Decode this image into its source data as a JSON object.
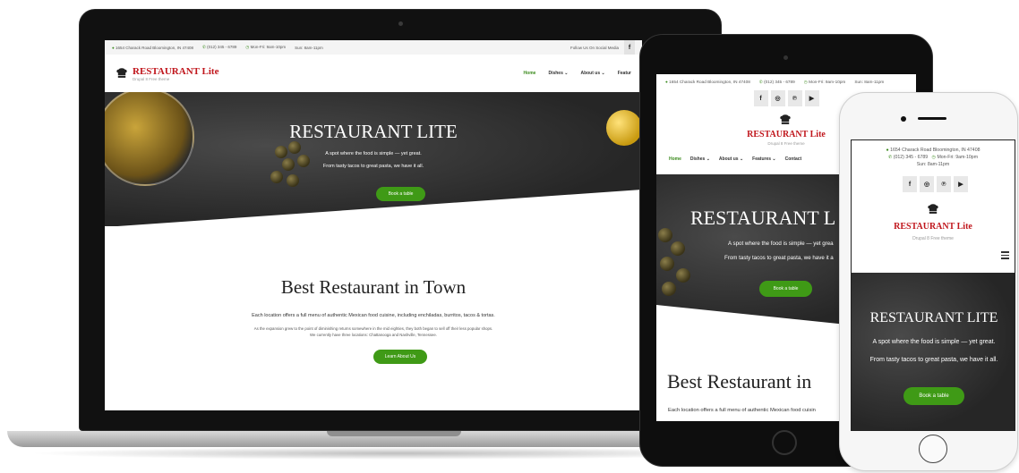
{
  "site": {
    "brand_title": "RESTAURANT Lite",
    "brand_tag": "Drupal 8 Free theme",
    "brand_tag_short": "Drupal 8 Free theme",
    "address": "1654 Charack Road Bloomington, IN 47408",
    "phone": "(012) 345 - 6789",
    "hours_weekday": "Mon-Fri: 9am-10pm",
    "hours_weekend": "Sun: 8am-11pm",
    "social_label": "Follow Us On Social Media",
    "nav": [
      "Home",
      "Dishes",
      "About us",
      "Features",
      "Contact"
    ],
    "nav_laptop_cut": "Featur",
    "hero_title": "RESTAURANT LITE",
    "hero_p1": "A spot where the food is simple — yet great.",
    "hero_p2": "From tasty tacos to great pasta, we have it all.",
    "hero_button": "Book a table",
    "section_title": "Best Restaurant in Town",
    "section_p1": "Each location offers a full menu of authentic Mexican food cuisine, including enchiladas, burritos, tacos & tortas.",
    "section_p2": "As the expansion grew to the point of diminishing returns somewhere in the mid eighties, they both began to sell off their less popular shops.",
    "section_p3": "We currently have three locations: Chattanooga and Nashville, Tennessee.",
    "section_button": "Learn About Us"
  },
  "tablet": {
    "hero_title": "RESTAURANT L",
    "hero_p1": "A spot where the food is simple — yet grea",
    "hero_p2": "From tasty tacos to great pasta, we have it a",
    "section_title": "Best Restaurant in",
    "section_p1": "Each location offers a full menu of authentic Mexican food cuisin"
  },
  "icons": {
    "facebook": "f",
    "instagram": "◎",
    "pinterest": "℗",
    "youtube": "▶"
  },
  "colors": {
    "brand_red": "#c0161c",
    "accent_green": "#3f9a16",
    "dark_hero": "#2b2b2b"
  }
}
